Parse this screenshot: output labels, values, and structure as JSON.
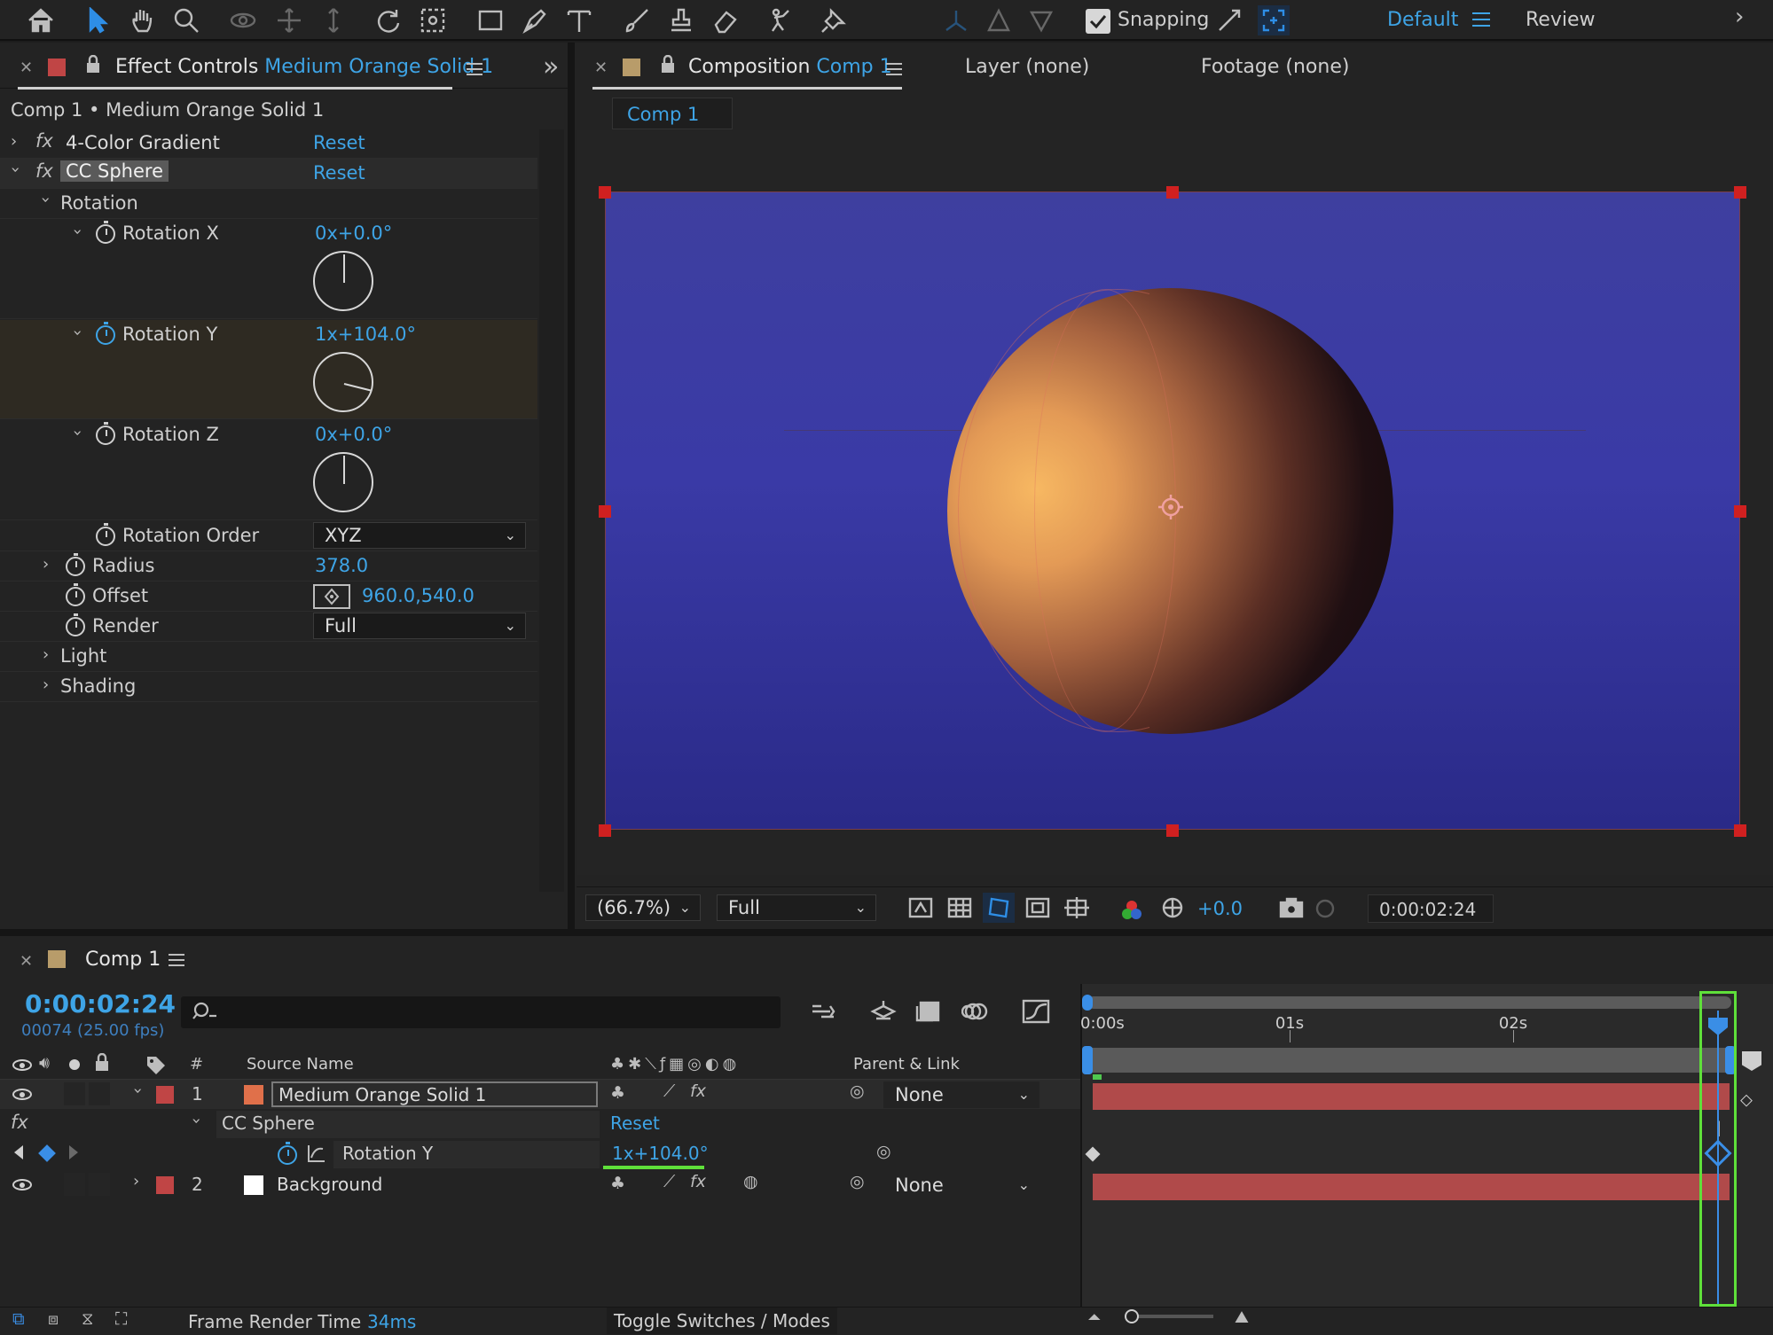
{
  "toolbar": {
    "snapping_label": "Snapping",
    "workspace_active": "Default",
    "workspace_other": "Review"
  },
  "effect_controls": {
    "tab_prefix": "Effect Controls",
    "tab_layer": "Medium Orange Solid 1",
    "breadcrumb": "Comp 1 • Medium Orange Solid 1",
    "effects": [
      {
        "name": "4-Color Gradient",
        "reset": "Reset"
      },
      {
        "name": "CC Sphere",
        "reset": "Reset"
      }
    ],
    "rotation_group": "Rotation",
    "rotation_x": {
      "label": "Rotation X",
      "value": "0x+0.0°",
      "angle": 0
    },
    "rotation_y": {
      "label": "Rotation Y",
      "value": "1x+104.0°",
      "angle": 104
    },
    "rotation_z": {
      "label": "Rotation Z",
      "value": "0x+0.0°",
      "angle": 0
    },
    "rotation_order": {
      "label": "Rotation Order",
      "value": "XYZ"
    },
    "radius": {
      "label": "Radius",
      "value": "378.0"
    },
    "offset": {
      "label": "Offset",
      "value": "960.0,540.0"
    },
    "render": {
      "label": "Render",
      "value": "Full"
    },
    "light": "Light",
    "shading": "Shading"
  },
  "composition": {
    "tab_prefix": "Composition",
    "tab_comp": "Comp 1",
    "layer_tab": "Layer (none)",
    "footage_tab": "Footage (none)",
    "breadcrumb": "Comp 1",
    "zoom": "(66.7%)",
    "resolution": "Full",
    "exposure": "+0.0",
    "timecode": "0:00:02:24"
  },
  "timeline": {
    "tab": "Comp 1",
    "timecode": "0:00:02:24",
    "frame_info": "00074 (25.00 fps)",
    "search_placeholder": "",
    "col_hash": "#",
    "col_source": "Source Name",
    "col_parent": "Parent & Link",
    "ruler": [
      "0:00s",
      "01s",
      "02s"
    ],
    "layers": [
      {
        "num": "1",
        "name": "Medium Orange Solid 1",
        "parent": "None",
        "color": "#e0704a"
      },
      {
        "num": "2",
        "name": "Background",
        "parent": "None",
        "color": "#ffffff"
      }
    ],
    "effect_name": "CC Sphere",
    "effect_reset": "Reset",
    "prop_name": "Rotation Y",
    "prop_value": "1x+104.0°",
    "render_time_label": "Frame Render Time",
    "render_time_value": "34ms",
    "toggle_label": "Toggle Switches / Modes"
  },
  "colors": {
    "accent": "#3ea4e6",
    "label_red": "#c04545",
    "highlight_green": "#5fe03a",
    "comp_bg": "#3b3ba2"
  }
}
